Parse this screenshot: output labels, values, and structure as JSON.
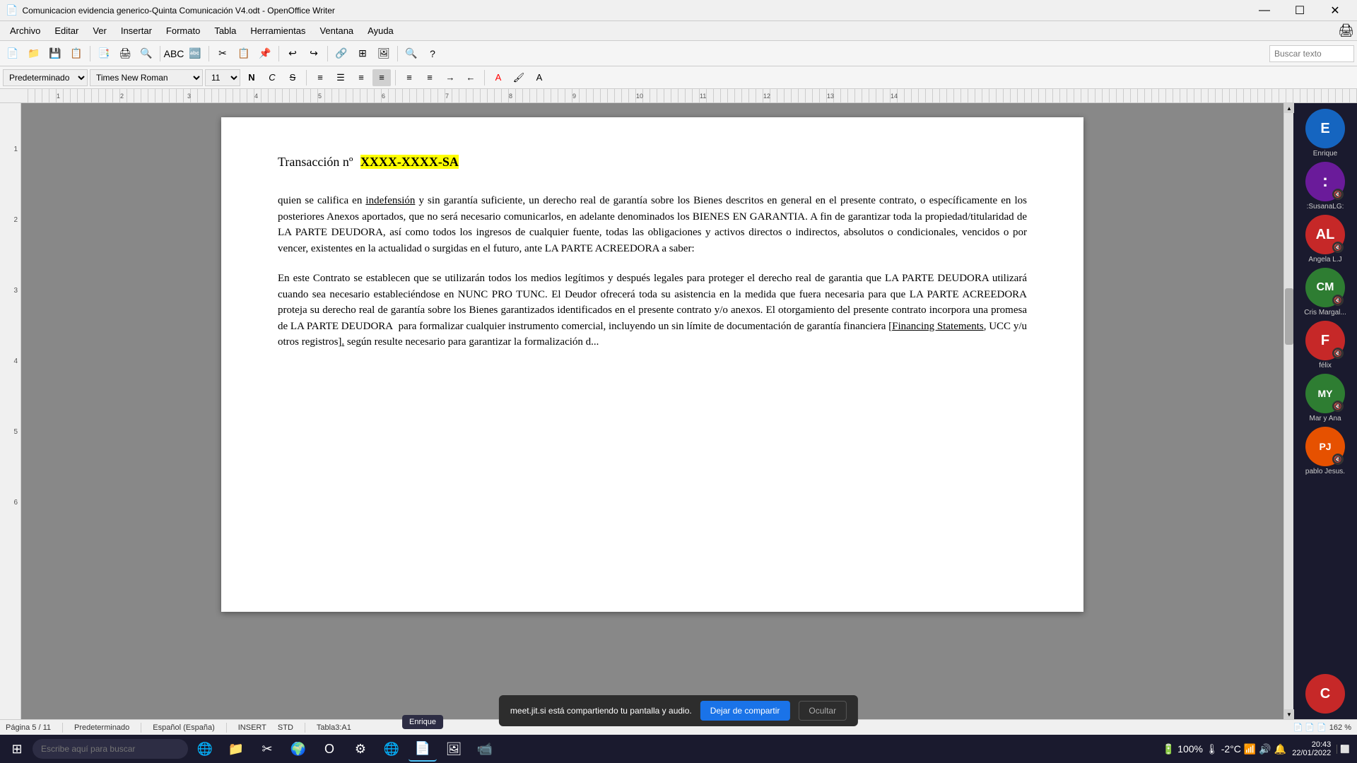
{
  "titlebar": {
    "title": "Comunicacion evidencia generico-Quinta Comunicación V4.odt - OpenOffice Writer",
    "icon": "📄"
  },
  "window_controls": {
    "minimize": "—",
    "maximize": "☐",
    "close": "✕"
  },
  "menubar": {
    "items": [
      "Archivo",
      "Editar",
      "Ver",
      "Insertar",
      "Formato",
      "Tabla",
      "Herramientas",
      "Ventana",
      "Ayuda"
    ]
  },
  "toolbar": {
    "search_placeholder": "Buscar texto"
  },
  "formattingbar": {
    "style": "Predeterminado",
    "font": "Times New Roman",
    "size": "11",
    "bold": "N",
    "italic": "C",
    "strikethrough": "S"
  },
  "document": {
    "title_prefix": "Transacción nº",
    "title_highlight": "XXXX-XXXX-SA",
    "paragraph1": "quien se califica en indefensión y sin garantía suficiente, un derecho real de garantía sobre los Bienes descritos en general en el presente contrato, o específicamente en los posteriores Anexos aportados, que no será necesario comunicarlos, en adelante denominados los BIENES EN GARANTIA. A fin de garantizar toda la propiedad/titularidad de LA PARTE DEUDORA, así como todos los ingresos de cualquier fuente, todas las obligaciones y activos directos o indirectos, absolutos o condicionales, vencidos o por vencer, existentes en la actualidad o surgidas en el futuro, ante LA PARTE ACREEDORA a saber:",
    "paragraph2": "En este Contrato se establecen que se utilizarán todos los medios legítimos y después legales para proteger el derecho real de garantia que LA PARTE DEUDORA utilizará cuando sea necesario estableciéndose en NUNC PRO TUNC. El Deudor ofrecerá toda su asistencia en la medida que fuera necesaria para que LA PARTE ACREEDORA proteja su derecho real de garantía sobre los Bienes garantizados identificados en el presente contrato y/o anexos. El otorgamiento del presente contrato incorpora una promesa de LA PARTE DEUDORA  para formalizar cualquier instrumento comercial, incluyendo un sin límite de documentación de garantía financiera [Financing Statements, UCC y/u otros registros], según resulte necesario para garantizar la formalización d..."
  },
  "participants": [
    {
      "initials": "E",
      "name": "Enrique",
      "color": "#1565c0",
      "muted": false
    },
    {
      "initials": ":",
      "name": ":SusanaLG:",
      "color": "#6a1b9a",
      "muted": true
    },
    {
      "initials": "AL",
      "name": "Angela L.J",
      "color": "#c62828",
      "muted": true
    },
    {
      "initials": "CM",
      "name": "Cris Margal...",
      "color": "#2e7d32",
      "muted": true
    },
    {
      "initials": "F",
      "name": "félix",
      "color": "#c62828",
      "muted": true
    },
    {
      "initials": "MY",
      "name": "Mar y Ana",
      "color": "#2e7d32",
      "muted": true
    },
    {
      "initials": "PJ",
      "name": "pablo Jesus.",
      "color": "#e65100",
      "muted": true
    },
    {
      "initials": "C",
      "name": "",
      "color": "#c62828",
      "muted": false
    }
  ],
  "statusbar": {
    "page": "Página 5 / 11",
    "style": "Predeterminado",
    "language": "Español (España)",
    "mode": "INSERT",
    "std": "STD",
    "table": "Tabla3:A1",
    "zoom": "162 %"
  },
  "notification": {
    "text": "meet.jit.si está compartiendo tu pantalla y audio.",
    "stop_btn": "Dejar de compartir",
    "hide_btn": "Ocultar"
  },
  "taskbar": {
    "search_placeholder": "Escribe aquí para buscar",
    "time": "20:43",
    "date": "22/01/2022",
    "battery": "100%",
    "temp": "-2°C",
    "tooltip_app": "Enrique"
  }
}
